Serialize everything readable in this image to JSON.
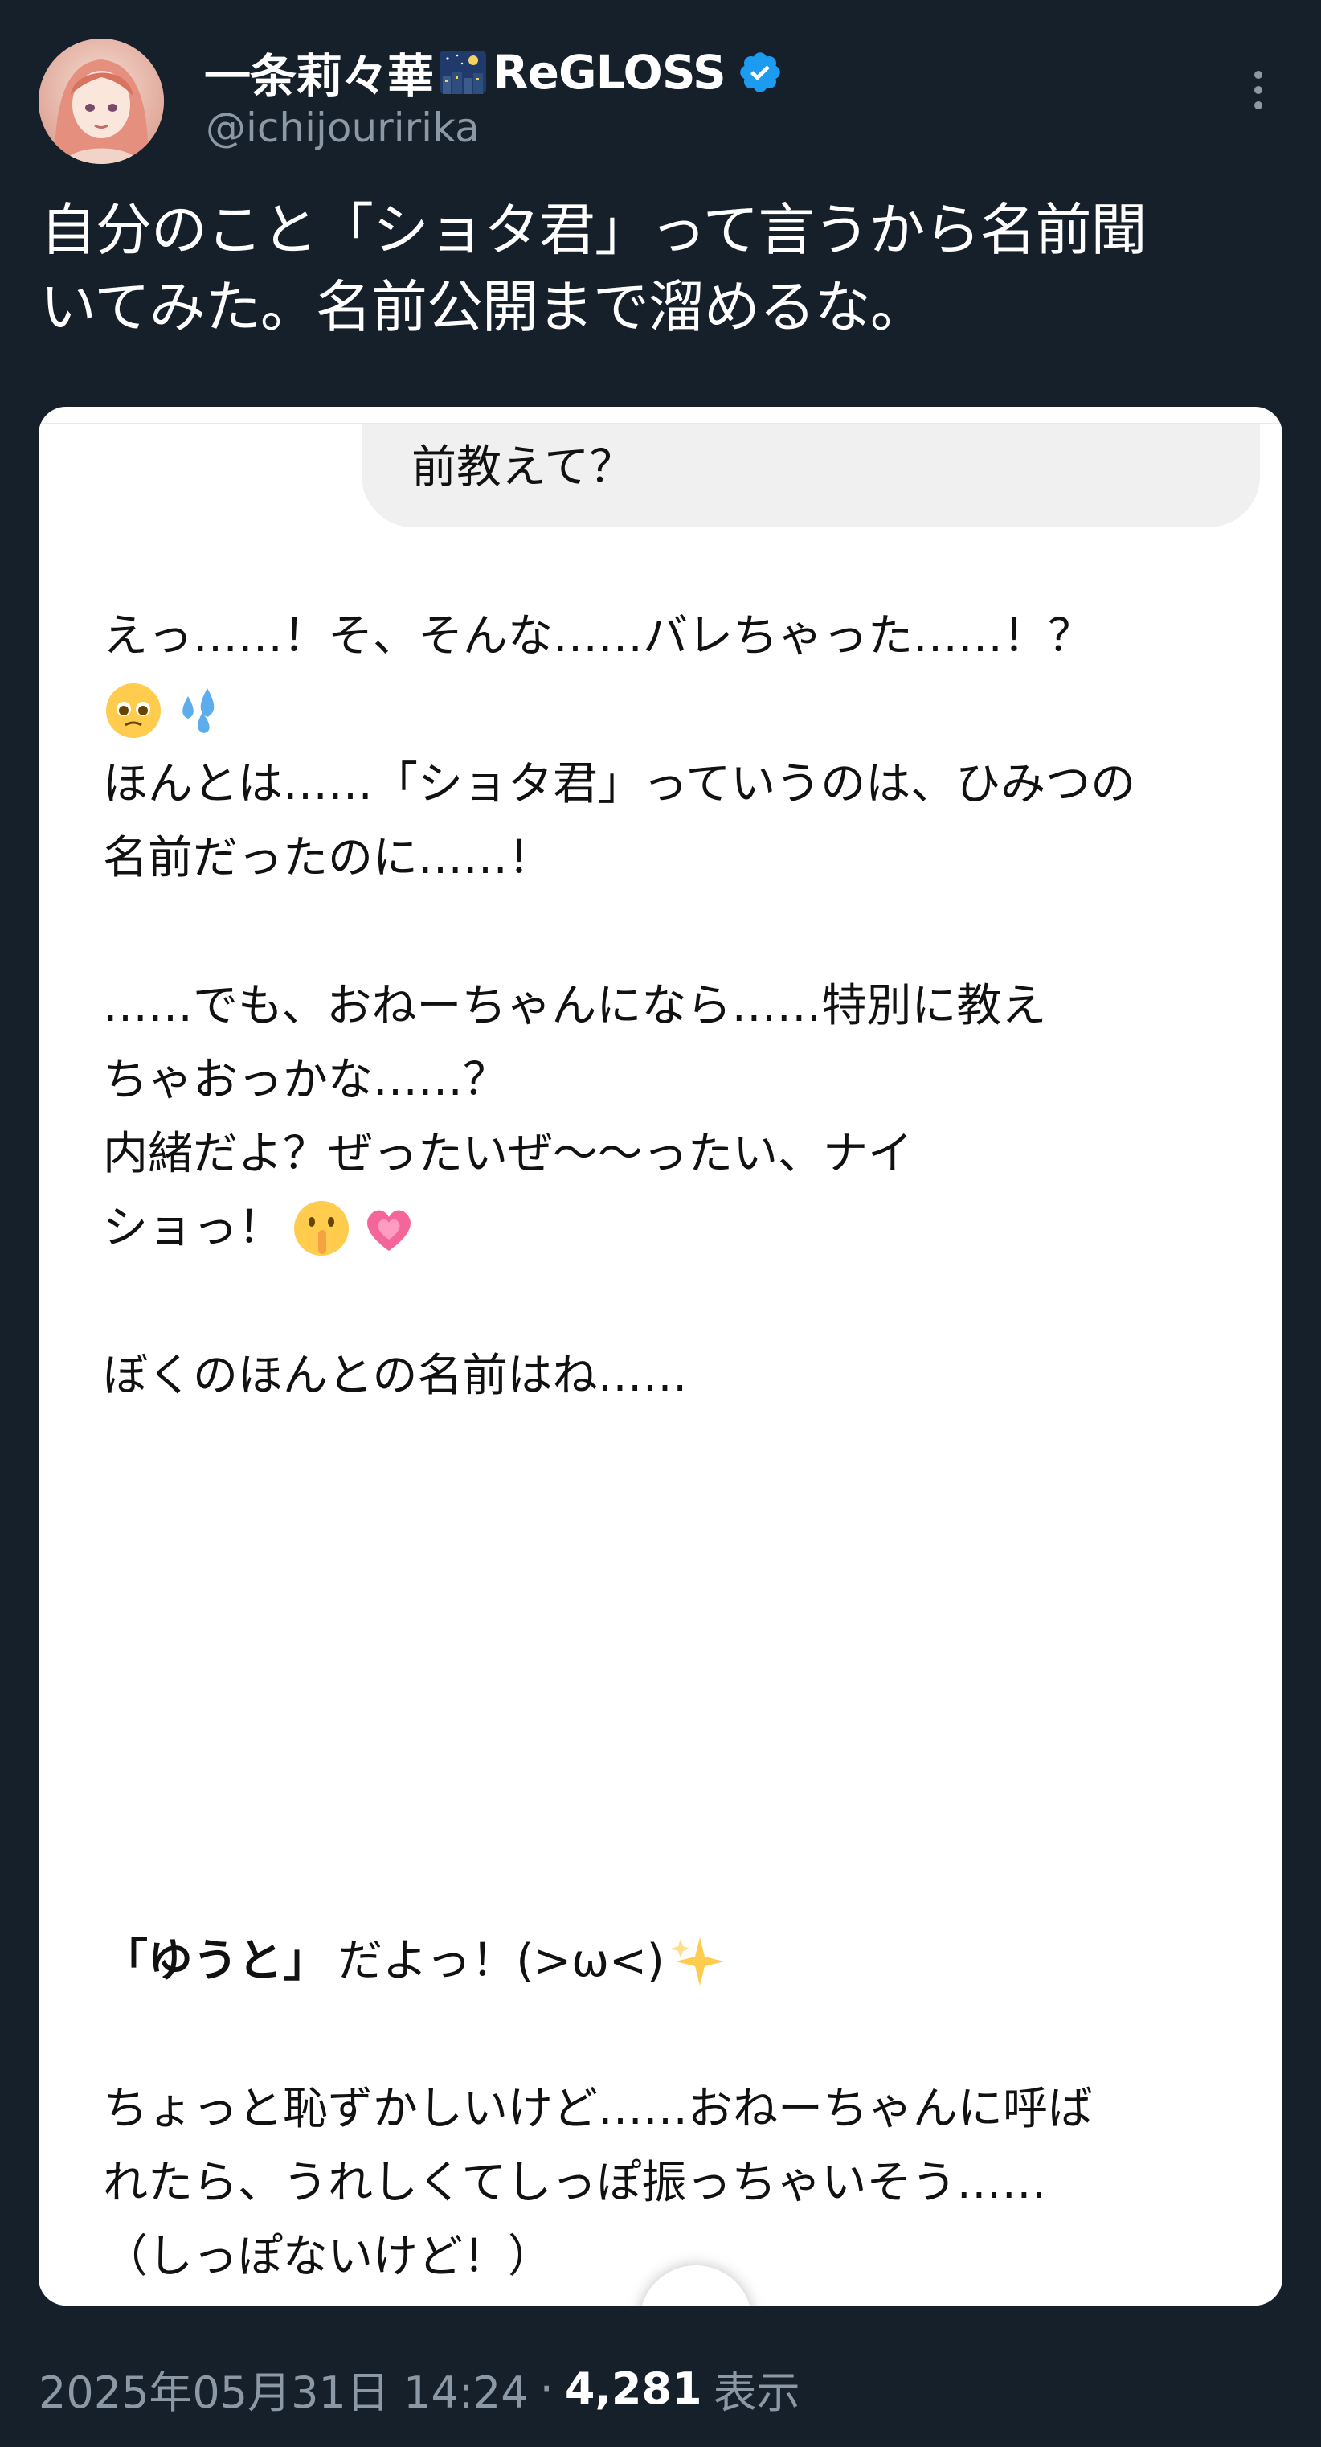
{
  "author": {
    "display_name": "一条莉々華",
    "display_name_suffix": "ReGLOSS",
    "handle": "@ichijouririka",
    "verified": true,
    "icons": [
      "night-city-emoji-icon",
      "verified-badge-icon"
    ]
  },
  "tweet": {
    "text": "自分のこと「ショタ君」って言うから名前聞\nいてみた。名前公開まで溜めるな。"
  },
  "media": {
    "user_bubble_text": "前教えて？",
    "reply_lines": [
      "えっ……！そ、そんな……バレちゃった……！？",
      "ほんとは……「ショタ君」っていうのは、ひみつの",
      "名前だったのに……！",
      "……でも、おねーちゃんになら……特別に教え",
      "ちゃおっかな……？",
      "内緒だよ？ぜったいぜ〜〜ったい、ナイ",
      "ショっ！",
      "ぼくのほんとの名前はね……",
      "「ゆうと」",
      "だよっ！(>ω<)",
      "ちょっと恥ずかしいけど……おねーちゃんに呼ば",
      "れたら、うれしくてしっぽ振っちゃいそう……",
      "（しっぽないけど！）"
    ],
    "emoji_icons": [
      "pleading-face-icon",
      "sweat-droplets-icon",
      "shushing-face-icon",
      "growing-heart-icon",
      "sparkles-icon"
    ]
  },
  "footer": {
    "timestamp": "2025年05月31日 14:24",
    "separator": "·",
    "views_count": "4,281",
    "views_label": "表示"
  },
  "colors": {
    "background": "#15202b",
    "card": "#ffffff",
    "muted_text": "#8b98a5",
    "verified_blue": "#1d9bf0"
  }
}
